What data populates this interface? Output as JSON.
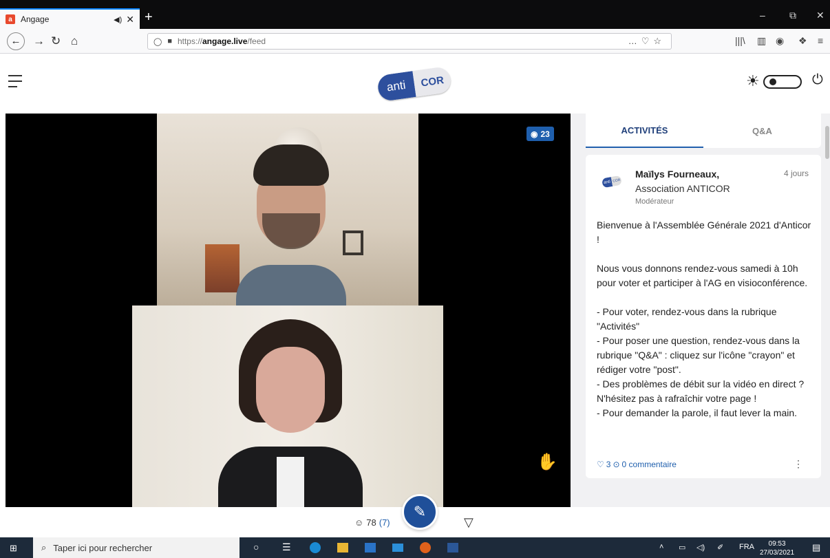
{
  "browser": {
    "tab_title": "Angage",
    "tab_favicon": "a",
    "audio_icon": "◀)",
    "close_icon": "✕",
    "new_tab": "+",
    "win_min": "–",
    "win_restore": "⧉",
    "win_close": "✕",
    "back": "←",
    "forward": "→",
    "reload": "↻",
    "home": "⌂",
    "url_prefix": "https://",
    "url_host": "angage.live",
    "url_path": "/feed",
    "url_actions": "…♡☆",
    "library": "|||\\",
    "sidebar": "▥",
    "account": "◉",
    "extensions": "❖",
    "menu": "≡"
  },
  "app": {
    "logo_left": "anti",
    "logo_right": "COR",
    "theme_icon": "☀",
    "power_icon": "⏻"
  },
  "video": {
    "viewer_icon": "◉",
    "viewer_count": "23",
    "raise_hand_icon": "✋"
  },
  "toolbar": {
    "attendees_icon": "☺",
    "attendees_total": "78",
    "attendees_highlight": "(7)",
    "compose_icon": "✎",
    "filter_icon": "▽"
  },
  "panel": {
    "tabs": [
      {
        "label": "ACTIVITÉS"
      },
      {
        "label": "Q&A"
      }
    ],
    "post": {
      "avatar_left": "anti",
      "avatar_right": "COR",
      "author": "Maïlys Fourneaux,",
      "organization": "Association ANTICOR",
      "role": "Modérateur",
      "time": "4 jours",
      "paragraphs": [
        "Bienvenue à l'Assemblée Générale 2021 d'Anticor !",
        " Nous vous donnons rendez-vous samedi à 10h pour voter et participer à l'AG en visioconférence.",
        "- Pour voter, rendez-vous dans la rubrique \"Activités\"",
        "- Pour poser une question, rendez-vous dans la rubrique \"Q&A\" : cliquez sur l'icône \"crayon\" et rédiger votre \"post\".",
        "- Des problèmes de débit sur la vidéo en direct ? N'hésitez pas à rafraîchir votre page !",
        "- Pour demander la parole, il faut lever la main."
      ],
      "likes_icon": "♡",
      "likes": "3",
      "comments_icon": "⊙",
      "comments": "0 commentaire",
      "more_icon": "⋮"
    }
  },
  "taskbar": {
    "start_icon": "⊞",
    "search_icon": "⌕",
    "search_placeholder": "Taper ici pour rechercher",
    "cortana_icon": "○",
    "taskview_icon": "☰",
    "tray_up": "˄",
    "battery": "▭",
    "volume": "◁)",
    "pen": "✐",
    "lang": "FRA",
    "time": "09:53",
    "date": "27/03/2021",
    "notif_icon": "▤"
  }
}
